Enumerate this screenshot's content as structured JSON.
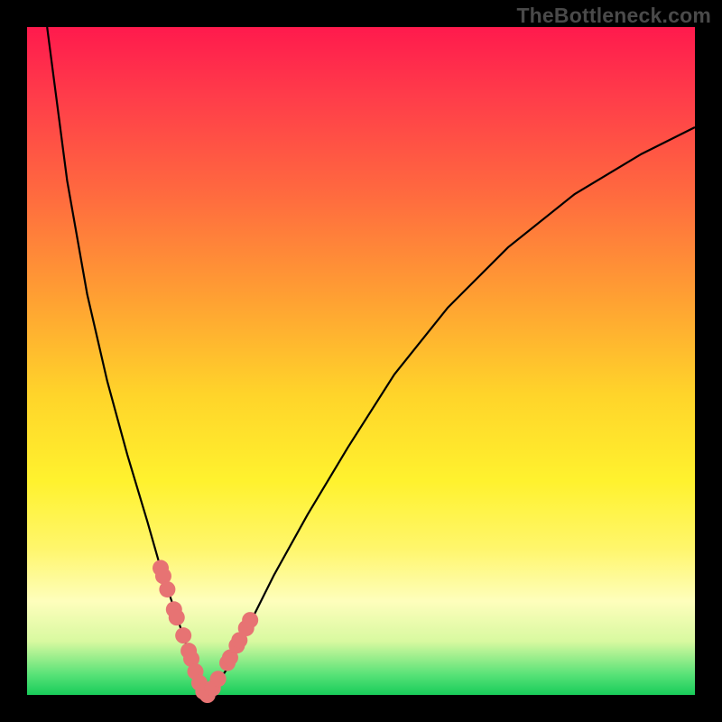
{
  "watermark": "TheBottleneck.com",
  "chart_data": {
    "type": "line",
    "title": "",
    "xlabel": "",
    "ylabel": "",
    "xlim": [
      0,
      100
    ],
    "ylim": [
      0,
      100
    ],
    "series": [
      {
        "name": "curve",
        "x": [
          3,
          6,
          9,
          12,
          15,
          18,
          20,
          22,
          24,
          25,
          26,
          27,
          28,
          30,
          33,
          37,
          42,
          48,
          55,
          63,
          72,
          82,
          92,
          100
        ],
        "y": [
          100,
          77,
          60,
          47,
          36,
          26,
          19,
          13,
          7,
          4,
          1,
          0,
          1,
          4,
          10,
          18,
          27,
          37,
          48,
          58,
          67,
          75,
          81,
          85
        ]
      }
    ],
    "markers": {
      "name": "highlight-points",
      "x": [
        20.0,
        20.4,
        21.0,
        22.0,
        22.4,
        23.4,
        24.2,
        24.6,
        25.2,
        25.8,
        26.4,
        27.0,
        27.8,
        28.6,
        30.0,
        30.4,
        31.4,
        31.8,
        32.8,
        33.4
      ],
      "y": [
        19.0,
        17.8,
        15.8,
        12.8,
        11.6,
        8.9,
        6.6,
        5.4,
        3.5,
        1.8,
        0.5,
        0.0,
        1.0,
        2.4,
        4.8,
        5.6,
        7.4,
        8.2,
        10.0,
        11.2
      ],
      "color": "#e77373",
      "radius_px": 9
    },
    "background_gradient": {
      "top": "#ff1a4d",
      "bottom": "#18cc5a"
    }
  }
}
